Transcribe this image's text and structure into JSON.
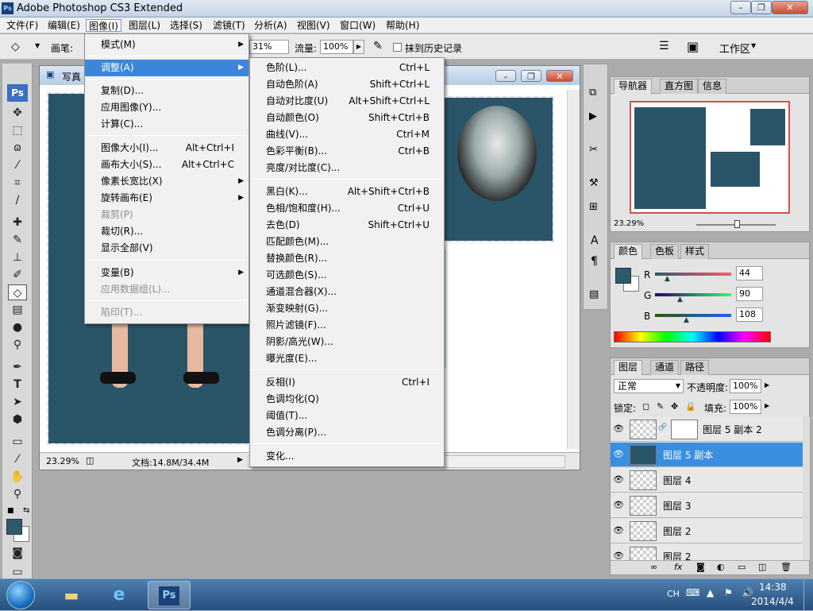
{
  "window": {
    "title": "Adobe Photoshop CS3 Extended",
    "icon": "ps-logo"
  },
  "menubar": [
    "文件(F)",
    "编辑(E)",
    "图像(I)",
    "图层(L)",
    "选择(S)",
    "滤镜(T)",
    "分析(A)",
    "视图(V)",
    "窗口(W)",
    "帮助(H)"
  ],
  "optbar": {
    "brush_label": "画笔:",
    "opacity_partial": "31%",
    "flow_label": "流量:",
    "flow_value": "100%",
    "history_label": "抹到历史记录",
    "workspace": "工作区"
  },
  "document": {
    "title": "写真",
    "zoom": "23.29%",
    "doc_info": "文档:14.8M/34.4M"
  },
  "image_menu": [
    {
      "label": "模式(M)",
      "arrow": true
    },
    {
      "label": "调整(A)",
      "arrow": true,
      "highlight": true
    },
    {
      "label": "复制(D)..."
    },
    {
      "label": "应用图像(Y)..."
    },
    {
      "label": "计算(C)..."
    },
    {
      "label": "图像大小(I)...",
      "shortcut": "Alt+Ctrl+I"
    },
    {
      "label": "画布大小(S)...",
      "shortcut": "Alt+Ctrl+C"
    },
    {
      "label": "像素长宽比(X)",
      "arrow": true
    },
    {
      "label": "旋转画布(E)",
      "arrow": true
    },
    {
      "label": "裁剪(P)",
      "disabled": true
    },
    {
      "label": "裁切(R)..."
    },
    {
      "label": "显示全部(V)"
    },
    {
      "label": "变量(B)",
      "arrow": true
    },
    {
      "label": "应用数据组(L)...",
      "disabled": true
    },
    {
      "label": "陷印(T)...",
      "disabled": true
    }
  ],
  "adjust_menu": [
    {
      "label": "色阶(L)...",
      "shortcut": "Ctrl+L"
    },
    {
      "label": "自动色阶(A)",
      "shortcut": "Shift+Ctrl+L"
    },
    {
      "label": "自动对比度(U)",
      "shortcut": "Alt+Shift+Ctrl+L"
    },
    {
      "label": "自动颜色(O)",
      "shortcut": "Shift+Ctrl+B"
    },
    {
      "label": "曲线(V)...",
      "shortcut": "Ctrl+M"
    },
    {
      "label": "色彩平衡(B)...",
      "shortcut": "Ctrl+B"
    },
    {
      "label": "亮度/对比度(C)..."
    },
    {
      "label": "黑白(K)...",
      "shortcut": "Alt+Shift+Ctrl+B"
    },
    {
      "label": "色相/饱和度(H)...",
      "shortcut": "Ctrl+U"
    },
    {
      "label": "去色(D)",
      "shortcut": "Shift+Ctrl+U"
    },
    {
      "label": "匹配颜色(M)..."
    },
    {
      "label": "替换颜色(R)..."
    },
    {
      "label": "可选颜色(S)..."
    },
    {
      "label": "通道混合器(X)..."
    },
    {
      "label": "渐变映射(G)..."
    },
    {
      "label": "照片滤镜(F)..."
    },
    {
      "label": "阴影/高光(W)..."
    },
    {
      "label": "曝光度(E)..."
    },
    {
      "label": "反相(I)",
      "shortcut": "Ctrl+I"
    },
    {
      "label": "色调均化(Q)"
    },
    {
      "label": "阈值(T)..."
    },
    {
      "label": "色调分离(P)..."
    },
    {
      "label": "变化..."
    }
  ],
  "navigator": {
    "tabs": [
      "导航器",
      "直方图",
      "信息"
    ],
    "zoom": "23.29%"
  },
  "color": {
    "tabs": [
      "颜色",
      "色板",
      "样式"
    ],
    "R": "44",
    "G": "90",
    "B": "108",
    "fg_color": "#2c5a6c"
  },
  "layers": {
    "tabs": [
      "图层",
      "通道",
      "路径"
    ],
    "blend_mode": "正常",
    "opacity_label": "不透明度:",
    "opacity": "100%",
    "lock_label": "锁定:",
    "fill_label": "填充:",
    "fill": "100%",
    "items": [
      {
        "name": "图层 5 副本 2",
        "selected": false
      },
      {
        "name": "图层 5 副本",
        "selected": true
      },
      {
        "name": "图层 4",
        "selected": false
      },
      {
        "name": "图层 3",
        "selected": false
      },
      {
        "name": "图层 2",
        "selected": false
      },
      {
        "name": "图层 2",
        "selected": false
      }
    ]
  },
  "taskbar": {
    "lang": "CH",
    "time": "14:38",
    "date": "2014/4/4"
  }
}
